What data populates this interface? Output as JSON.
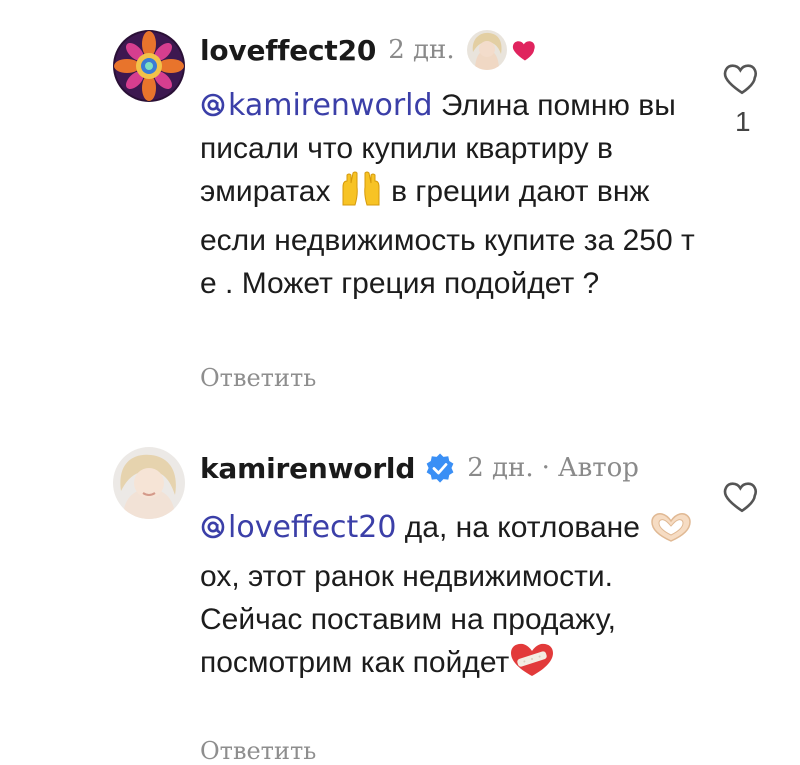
{
  "comments": [
    {
      "username": "loveffect20",
      "time": "2 дн.",
      "mention": "kamirenworld",
      "text_parts": [
        " Элина помню вы писали что купили квартиру в эмиратах ",
        " в греции дают внж если недвижимость купите за 250 т е . Может греция подойдет ?"
      ],
      "emoji_1": "raising-hands-emoji",
      "reply_label": "Ответить",
      "like_count": "1",
      "liked_by_author": true
    },
    {
      "username": "kamirenworld",
      "time": "2 дн.",
      "separator": "·",
      "author_label": "Автор",
      "mention": "loveffect20",
      "text_parts": [
        " да, на котловане ",
        " ох, этот ранок недвижимости. Сейчас поставим на продажу, посмотрим как пойдет"
      ],
      "emoji_1": "heart-hands-emoji",
      "emoji_2": "mending-heart-emoji",
      "reply_label": "Ответить"
    }
  ],
  "colors": {
    "mention": "#3b3fa8",
    "meta": "#8a8a8a",
    "verified": "#3a8ff5",
    "heart": "#e0245e"
  }
}
